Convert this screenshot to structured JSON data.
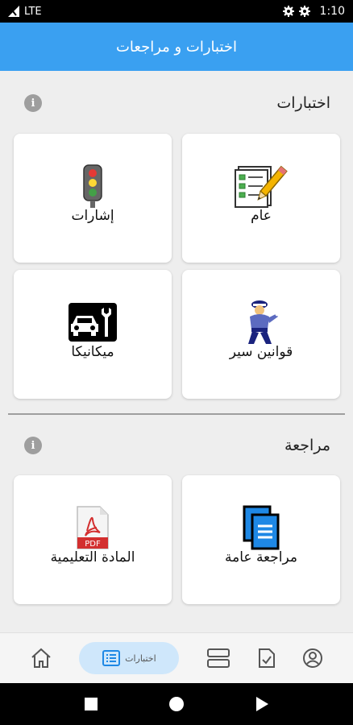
{
  "status_bar": {
    "network": "LTE",
    "time": "1:10"
  },
  "app_bar": {
    "title": "اختبارات و مراجعات"
  },
  "sections": {
    "tests": {
      "title": "اختبارات",
      "cards": [
        {
          "label": "عام",
          "icon": "checklist-pencil-icon"
        },
        {
          "label": "إشارات",
          "icon": "traffic-light-icon"
        },
        {
          "label": "قوانين سير",
          "icon": "traffic-police-icon"
        },
        {
          "label": "ميكانيكا",
          "icon": "car-wrench-icon"
        }
      ]
    },
    "review": {
      "title": "مراجعة",
      "cards": [
        {
          "label": "مراجعة عامة",
          "icon": "documents-icon"
        },
        {
          "label": "المادة التعليمية",
          "icon": "pdf-file-icon"
        }
      ]
    }
  },
  "bottom_nav": {
    "items": [
      {
        "icon": "home-icon"
      },
      {
        "label": "اختبارات",
        "icon": "list-icon",
        "active": true
      },
      {
        "icon": "stacked-rectangles-icon"
      },
      {
        "icon": "file-check-icon"
      },
      {
        "icon": "account-icon"
      }
    ]
  },
  "colors": {
    "app_bar": "#3aa0f1",
    "active_tab": "#cfe7fb",
    "background": "#eeeeee"
  }
}
